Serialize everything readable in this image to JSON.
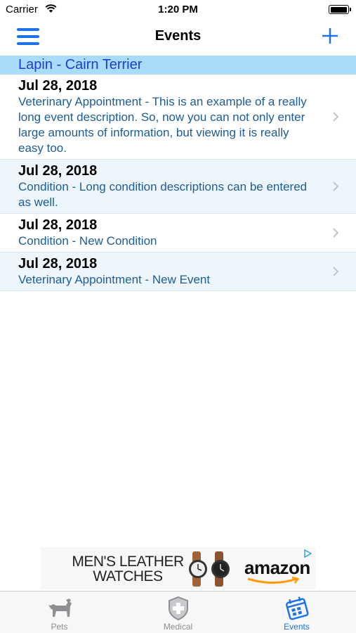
{
  "status_bar": {
    "carrier": "Carrier",
    "time": "1:20 PM",
    "battery_level": 0.9
  },
  "nav": {
    "title": "Events",
    "menu_icon": "hamburger-menu-icon",
    "add_icon": "plus-icon"
  },
  "section": {
    "title": "Lapin - Cairn Terrier"
  },
  "events": [
    {
      "date": "Jul 28, 2018",
      "description": "Veterinary Appointment - This is an example of a really long event description. So, now you can not only enter large amounts of information, but viewing it is really easy too."
    },
    {
      "date": "Jul 28, 2018",
      "description": "Condition - Long condition descriptions can be entered as well."
    },
    {
      "date": "Jul 28, 2018",
      "description": "Condition - New Condition"
    },
    {
      "date": "Jul 28, 2018",
      "description": "Veterinary Appointment - New Event"
    }
  ],
  "ad": {
    "line1": "MEN'S LEATHER",
    "line2": "WATCHES",
    "brand": "amazon"
  },
  "tabs": [
    {
      "label": "Pets",
      "icon": "dog-icon",
      "active": false
    },
    {
      "label": "Medical",
      "icon": "medical-shield-icon",
      "active": false
    },
    {
      "label": "Events",
      "icon": "calendar-icon",
      "active": true
    }
  ],
  "colors": {
    "accent": "#1a73e8",
    "section_bg": "#a9dbfa",
    "section_text": "#1b3fd0",
    "desc_text": "#1d5c94",
    "alt_row": "#eef6fd"
  }
}
